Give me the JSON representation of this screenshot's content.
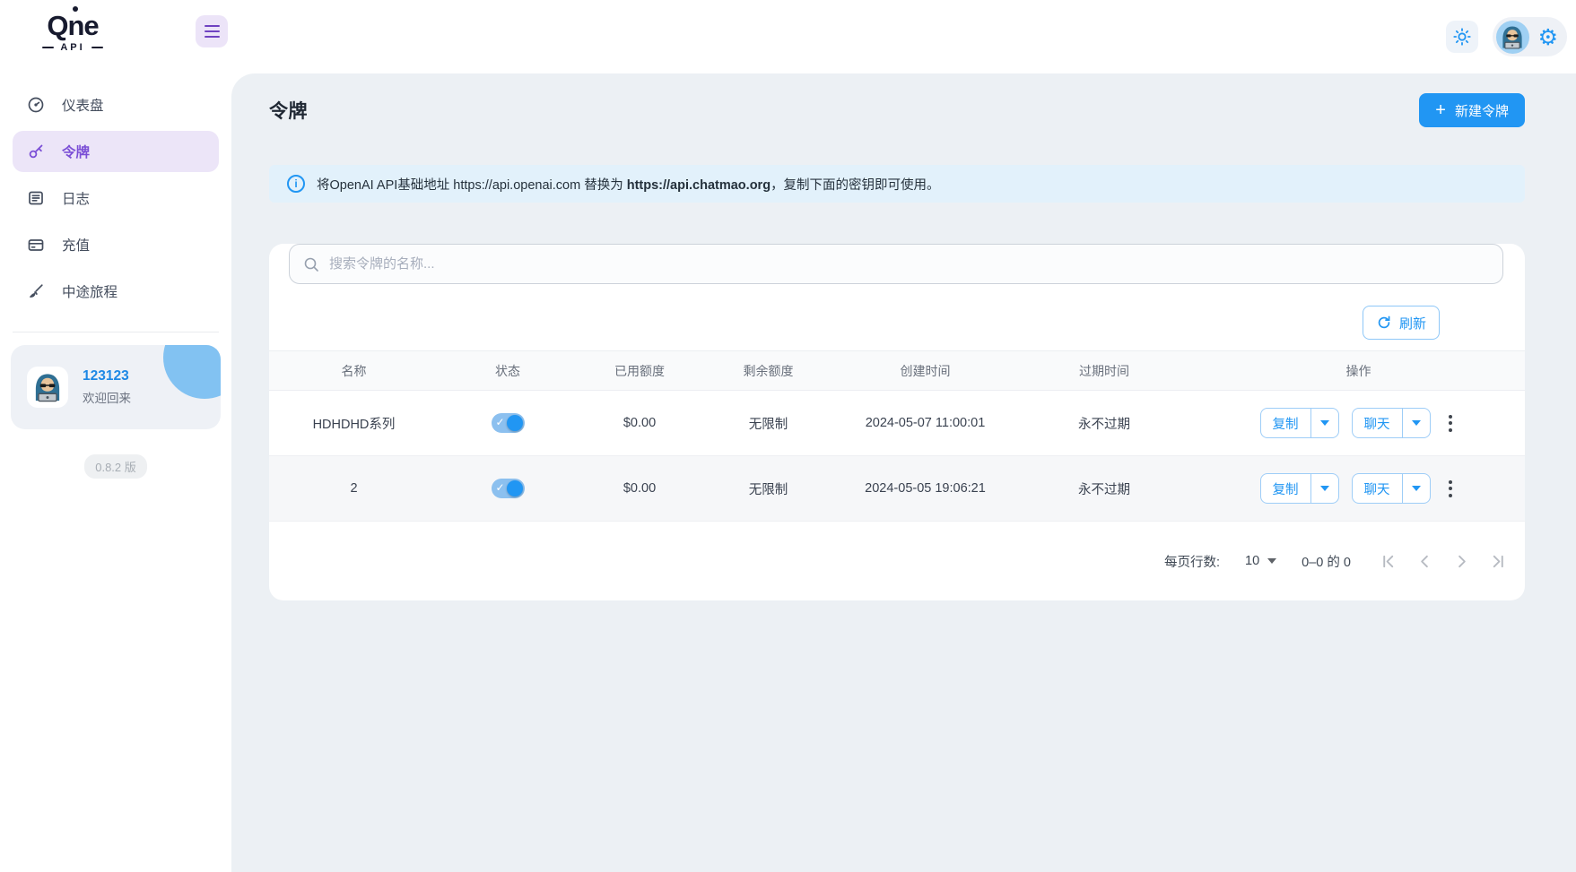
{
  "brand": {
    "name_q": "Q",
    "name_n": "n",
    "name_e": "e",
    "sub": "API"
  },
  "sidebar": {
    "items": [
      {
        "label": "仪表盘"
      },
      {
        "label": "令牌"
      },
      {
        "label": "日志"
      },
      {
        "label": "充值"
      },
      {
        "label": "中途旅程"
      }
    ],
    "user": {
      "name": "123123",
      "greeting": "欢迎回来"
    },
    "version": "0.8.2 版"
  },
  "page": {
    "title": "令牌",
    "new_token_label": "新建令牌"
  },
  "notice": {
    "prefix": "将OpenAI API基础地址 https://api.openai.com 替换为 ",
    "highlight": "https://api.chatmao.org",
    "suffix": "，复制下面的密钥即可使用。"
  },
  "search": {
    "placeholder": "搜索令牌的名称..."
  },
  "toolbar": {
    "refresh_label": "刷新"
  },
  "table": {
    "headers": [
      "名称",
      "状态",
      "已用额度",
      "剩余额度",
      "创建时间",
      "过期时间",
      "操作"
    ],
    "actions": {
      "copy_label": "复制",
      "chat_label": "聊天"
    },
    "rows": [
      {
        "name": "HDHDHD系列",
        "status": "on",
        "used_quota": "$0.00",
        "remaining_quota": "无限制",
        "created_time": "2024-05-07 11:00:01",
        "expire_time": "永不过期"
      },
      {
        "name": "2",
        "status": "on",
        "used_quota": "$0.00",
        "remaining_quota": "无限制",
        "created_time": "2024-05-05 19:06:21",
        "expire_time": "永不过期"
      }
    ]
  },
  "pagination": {
    "rows_per_page_label": "每页行数:",
    "rows_per_page": "10",
    "range_label": "0–0 的 0"
  },
  "colors": {
    "primary_blue": "#2196f3",
    "link_blue": "#1e88e5",
    "active_purple": "#7b4fd6",
    "active_purple_bg": "#ece5f8",
    "notice_bg": "#e2f1fb",
    "content_bg": "#ecf0f4",
    "toggle_track": "#8cc0ef"
  }
}
